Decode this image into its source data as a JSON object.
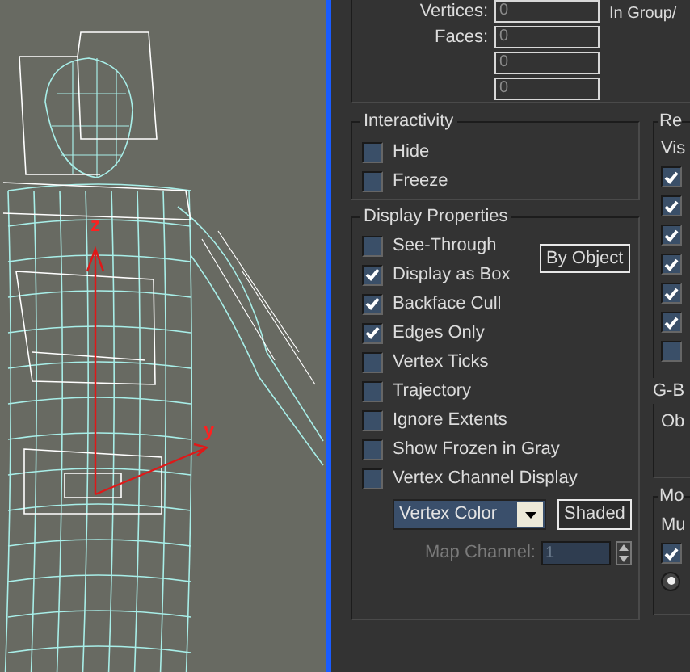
{
  "viewport": {
    "axis_labels": [
      "z",
      "y"
    ]
  },
  "stats": {
    "fields": [
      {
        "label": "Vertices:",
        "value": "0"
      },
      {
        "label": "Faces:",
        "value": "0"
      },
      {
        "value": "0"
      },
      {
        "value": "0"
      }
    ],
    "side_label": "In Group/"
  },
  "interactivity": {
    "title": "Interactivity",
    "options": [
      {
        "label": "Hide",
        "checked": false
      },
      {
        "label": "Freeze",
        "checked": false
      }
    ]
  },
  "display_properties": {
    "title": "Display Properties",
    "by_object_button": "By Object",
    "options": [
      {
        "label": "See-Through",
        "checked": false
      },
      {
        "label": "Display as Box",
        "checked": true
      },
      {
        "label": "Backface Cull",
        "checked": true
      },
      {
        "label": "Edges Only",
        "checked": true
      },
      {
        "label": "Vertex Ticks",
        "checked": false
      },
      {
        "label": "Trajectory",
        "checked": false
      },
      {
        "label": "Ignore Extents",
        "checked": false
      },
      {
        "label": "Show Frozen in Gray",
        "checked": false
      },
      {
        "label": "Vertex Channel Display",
        "checked": false
      }
    ],
    "dropdown": {
      "value": "Vertex Color"
    },
    "shaded_button": "Shaded",
    "map_channel": {
      "label": "Map Channel:",
      "value": "1",
      "disabled": true
    }
  },
  "right_panel": {
    "rendering_title": "Re",
    "visibility_label": "Vis",
    "checkboxes": [
      {
        "checked": true
      },
      {
        "checked": true
      },
      {
        "checked": true
      },
      {
        "checked": true
      },
      {
        "checked": true
      },
      {
        "checked": true
      },
      {
        "checked": false
      }
    ],
    "gbuffer_title": "G-B",
    "object_label": "Ob",
    "motion_title": "Mo",
    "multiplier_label": "Mu",
    "motion_checkbox": {
      "checked": true
    },
    "radio": {
      "selected": true
    }
  }
}
